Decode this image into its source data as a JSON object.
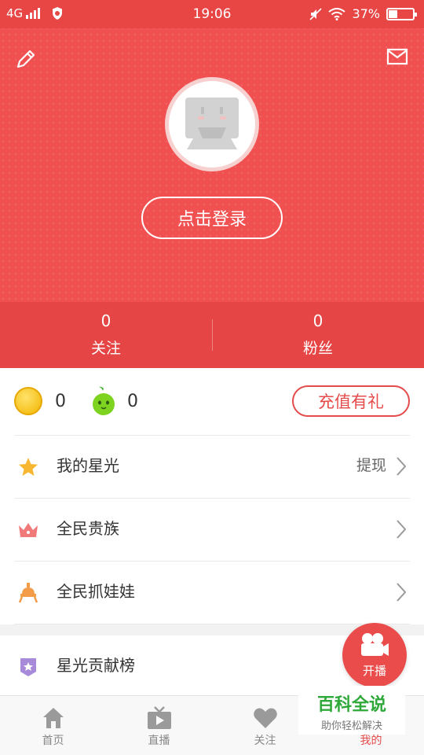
{
  "status_bar": {
    "network": "4G",
    "time": "19:06",
    "battery": "37%"
  },
  "profile": {
    "login_label": "点击登录"
  },
  "stats": {
    "following_count": "0",
    "following_label": "关注",
    "fans_count": "0",
    "fans_label": "粉丝"
  },
  "wallet": {
    "coins": "0",
    "beans": "0",
    "recharge_label": "充值有礼"
  },
  "menu": [
    {
      "label": "我的星光",
      "action": "提现",
      "icon": "star-icon"
    },
    {
      "label": "全民贵族",
      "icon": "crown-icon"
    },
    {
      "label": "全民抓娃娃",
      "icon": "claw-machine-icon"
    },
    {
      "label": "星光贡献榜",
      "icon": "badge-icon"
    }
  ],
  "live_button": {
    "label": "开播"
  },
  "tabs": [
    {
      "label": "首页",
      "icon": "home-icon"
    },
    {
      "label": "直播",
      "icon": "tv-icon"
    },
    {
      "label": "关注",
      "icon": "heart-icon"
    },
    {
      "label": "我的",
      "icon": "user-icon",
      "active": true
    }
  ],
  "watermark": {
    "title": "百科全说",
    "subtitle": "助你轻松解决"
  },
  "colors": {
    "primary": "#f05050",
    "stats_bg": "#e54545",
    "accent": "#e54b4b"
  }
}
